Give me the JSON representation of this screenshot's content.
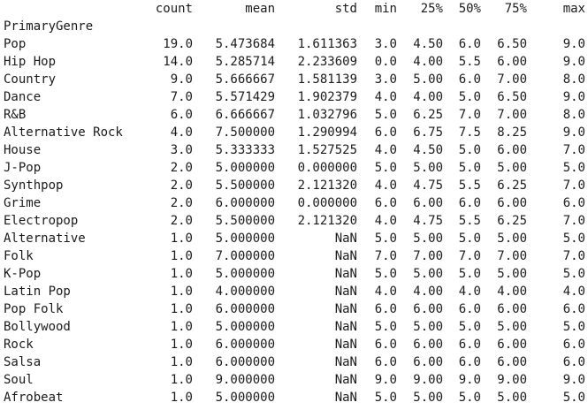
{
  "table": {
    "index_name": "PrimaryGenre",
    "columns": [
      "count",
      "mean",
      "std",
      "min",
      "25%",
      "50%",
      "75%",
      "max"
    ],
    "rows": [
      {
        "index": "Pop",
        "values": [
          "19.0",
          "5.473684",
          "1.611363",
          "3.0",
          "4.50",
          "6.0",
          "6.50",
          "9.0"
        ]
      },
      {
        "index": "Hip Hop",
        "values": [
          "14.0",
          "5.285714",
          "2.233609",
          "0.0",
          "4.00",
          "5.5",
          "6.00",
          "9.0"
        ]
      },
      {
        "index": "Country",
        "values": [
          "9.0",
          "5.666667",
          "1.581139",
          "3.0",
          "5.00",
          "6.0",
          "7.00",
          "8.0"
        ]
      },
      {
        "index": "Dance",
        "values": [
          "7.0",
          "5.571429",
          "1.902379",
          "4.0",
          "4.00",
          "5.0",
          "6.50",
          "9.0"
        ]
      },
      {
        "index": "R&B",
        "values": [
          "6.0",
          "6.666667",
          "1.032796",
          "5.0",
          "6.25",
          "7.0",
          "7.00",
          "8.0"
        ]
      },
      {
        "index": "Alternative Rock",
        "values": [
          "4.0",
          "7.500000",
          "1.290994",
          "6.0",
          "6.75",
          "7.5",
          "8.25",
          "9.0"
        ]
      },
      {
        "index": "House",
        "values": [
          "3.0",
          "5.333333",
          "1.527525",
          "4.0",
          "4.50",
          "5.0",
          "6.00",
          "7.0"
        ]
      },
      {
        "index": "J-Pop",
        "values": [
          "2.0",
          "5.000000",
          "0.000000",
          "5.0",
          "5.00",
          "5.0",
          "5.00",
          "5.0"
        ]
      },
      {
        "index": "Synthpop",
        "values": [
          "2.0",
          "5.500000",
          "2.121320",
          "4.0",
          "4.75",
          "5.5",
          "6.25",
          "7.0"
        ]
      },
      {
        "index": "Grime",
        "values": [
          "2.0",
          "6.000000",
          "0.000000",
          "6.0",
          "6.00",
          "6.0",
          "6.00",
          "6.0"
        ]
      },
      {
        "index": "Electropop",
        "values": [
          "2.0",
          "5.500000",
          "2.121320",
          "4.0",
          "4.75",
          "5.5",
          "6.25",
          "7.0"
        ]
      },
      {
        "index": "Alternative",
        "values": [
          "1.0",
          "5.000000",
          "NaN",
          "5.0",
          "5.00",
          "5.0",
          "5.00",
          "5.0"
        ]
      },
      {
        "index": "Folk",
        "values": [
          "1.0",
          "7.000000",
          "NaN",
          "7.0",
          "7.00",
          "7.0",
          "7.00",
          "7.0"
        ]
      },
      {
        "index": "K-Pop",
        "values": [
          "1.0",
          "5.000000",
          "NaN",
          "5.0",
          "5.00",
          "5.0",
          "5.00",
          "5.0"
        ]
      },
      {
        "index": "Latin Pop",
        "values": [
          "1.0",
          "4.000000",
          "NaN",
          "4.0",
          "4.00",
          "4.0",
          "4.00",
          "4.0"
        ]
      },
      {
        "index": "Pop Folk",
        "values": [
          "1.0",
          "6.000000",
          "NaN",
          "6.0",
          "6.00",
          "6.0",
          "6.00",
          "6.0"
        ]
      },
      {
        "index": "Bollywood",
        "values": [
          "1.0",
          "5.000000",
          "NaN",
          "5.0",
          "5.00",
          "5.0",
          "5.00",
          "5.0"
        ]
      },
      {
        "index": "Rock",
        "values": [
          "1.0",
          "6.000000",
          "NaN",
          "6.0",
          "6.00",
          "6.0",
          "6.00",
          "6.0"
        ]
      },
      {
        "index": "Salsa",
        "values": [
          "1.0",
          "6.000000",
          "NaN",
          "6.0",
          "6.00",
          "6.0",
          "6.00",
          "6.0"
        ]
      },
      {
        "index": "Soul",
        "values": [
          "1.0",
          "9.000000",
          "NaN",
          "9.0",
          "9.00",
          "9.0",
          "9.00",
          "9.0"
        ]
      },
      {
        "index": "Afrobeat",
        "values": [
          "1.0",
          "5.000000",
          "NaN",
          "5.0",
          "5.00",
          "5.0",
          "5.00",
          "5.0"
        ]
      }
    ]
  }
}
